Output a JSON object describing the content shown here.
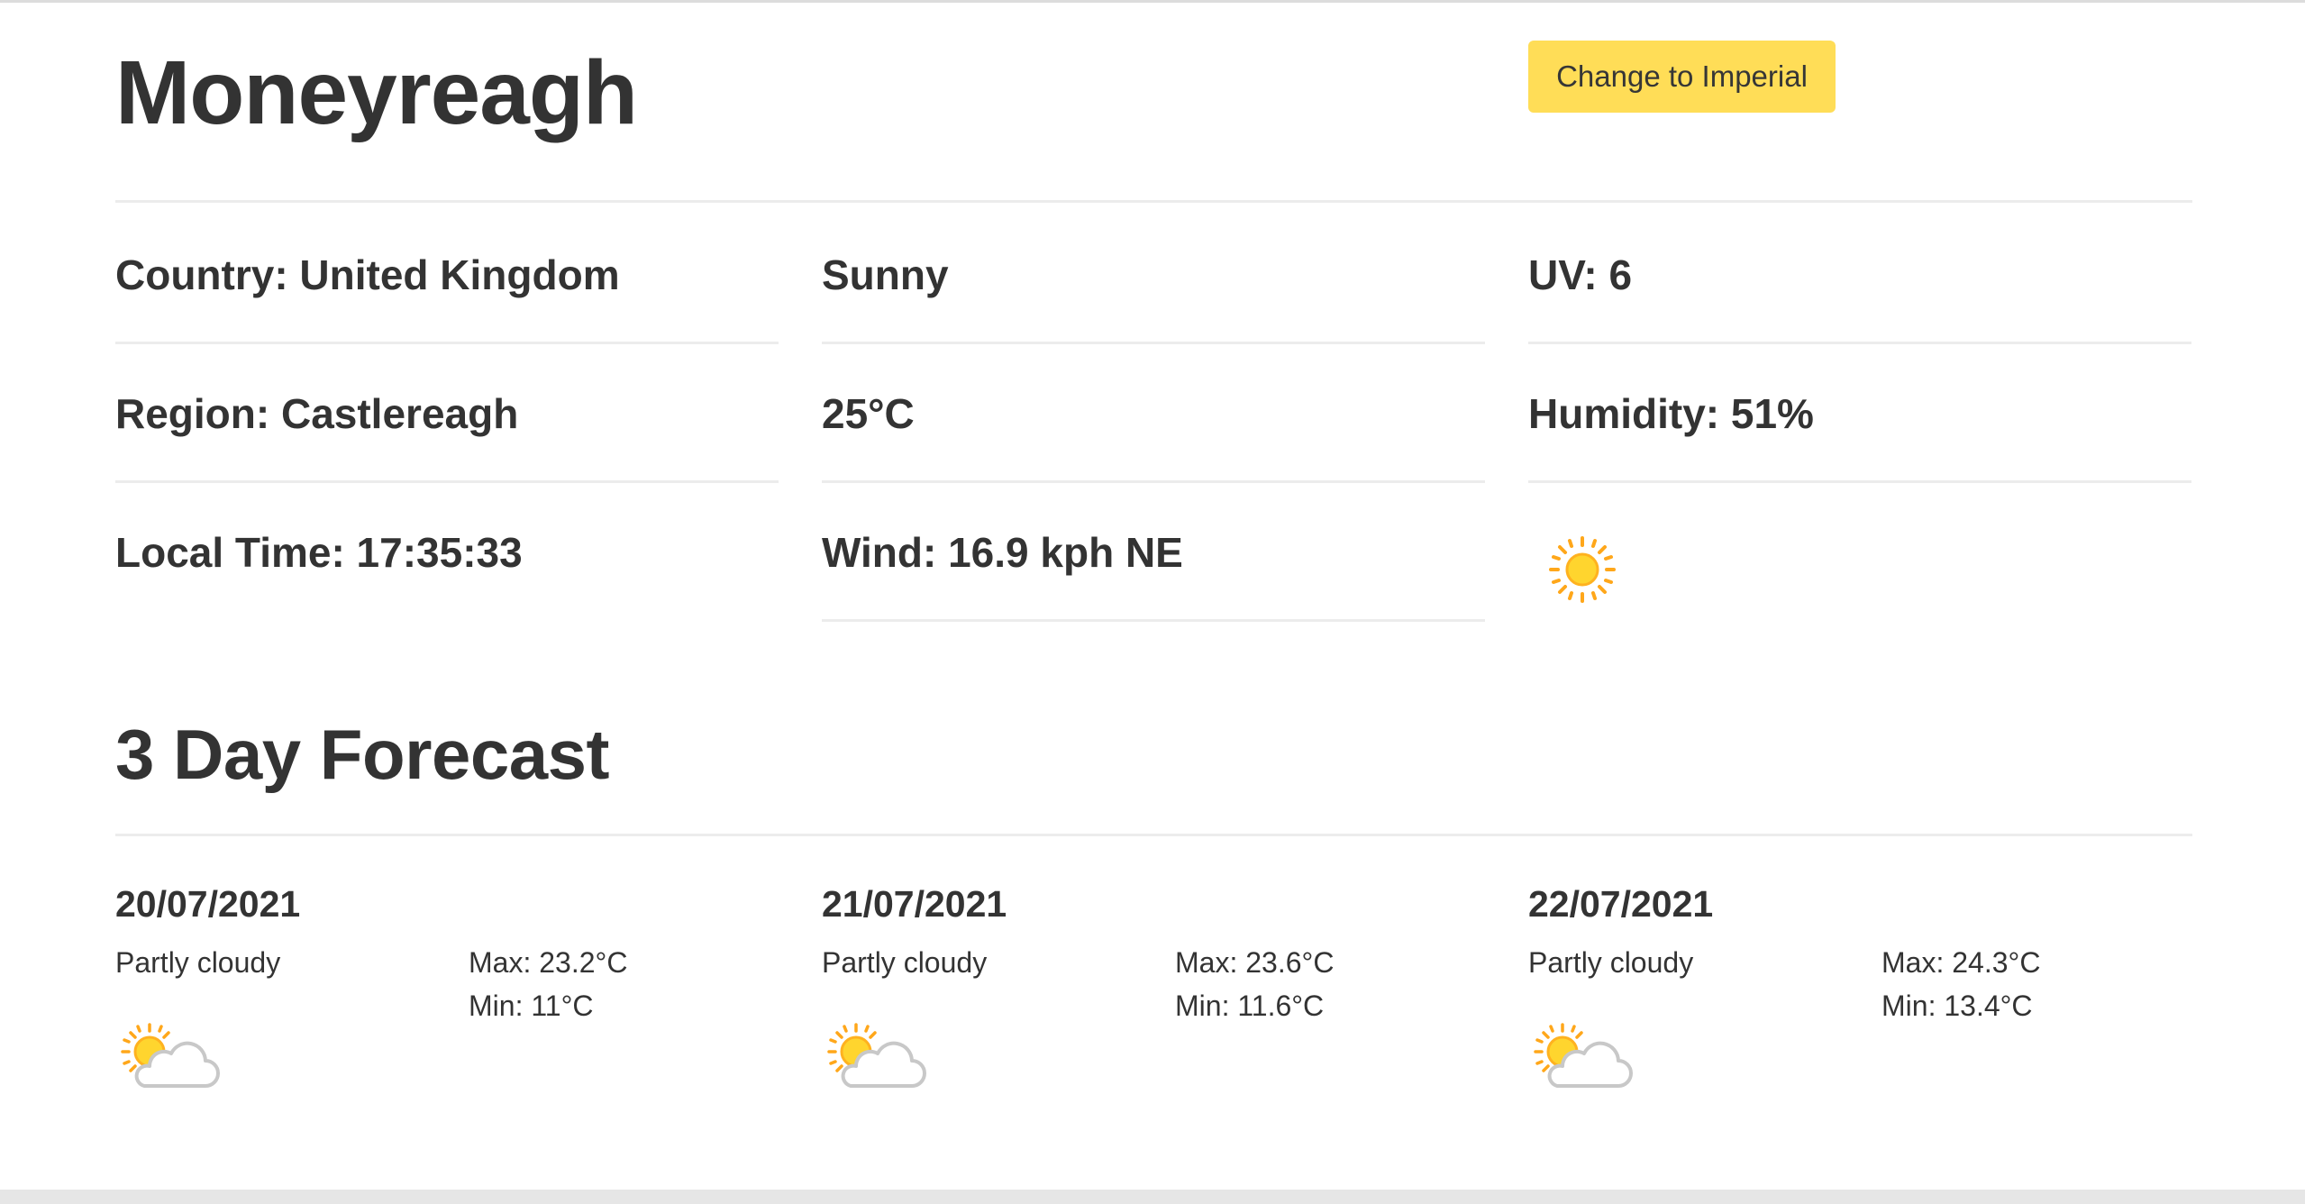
{
  "header": {
    "city": "Moneyreagh",
    "units_button_label": "Change to Imperial"
  },
  "current": {
    "country": "Country: United Kingdom",
    "region": "Region: Castlereagh",
    "local_time": "Local Time: 17:35:33",
    "condition": "Sunny",
    "temperature": "25°C",
    "wind": "Wind: 16.9 kph NE",
    "uv": "UV: 6",
    "humidity": "Humidity: 51%",
    "condition_icon": "sun-icon"
  },
  "forecast": {
    "title": "3 Day Forecast",
    "days": [
      {
        "date": "20/07/2021",
        "condition": "Partly cloudy",
        "max": "Max: 23.2°C",
        "min": "Min: 11°C",
        "icon": "partly-cloudy-icon"
      },
      {
        "date": "21/07/2021",
        "condition": "Partly cloudy",
        "max": "Max: 23.6°C",
        "min": "Min: 11.6°C",
        "icon": "partly-cloudy-icon"
      },
      {
        "date": "22/07/2021",
        "condition": "Partly cloudy",
        "max": "Max: 24.3°C",
        "min": "Min: 13.4°C",
        "icon": "partly-cloudy-icon"
      }
    ]
  },
  "colors": {
    "button_background": "#ffdd57",
    "text": "#333333",
    "divider": "#ececec",
    "sun_yellow": "#ffd52e",
    "sun_orange": "#ffa71a"
  }
}
